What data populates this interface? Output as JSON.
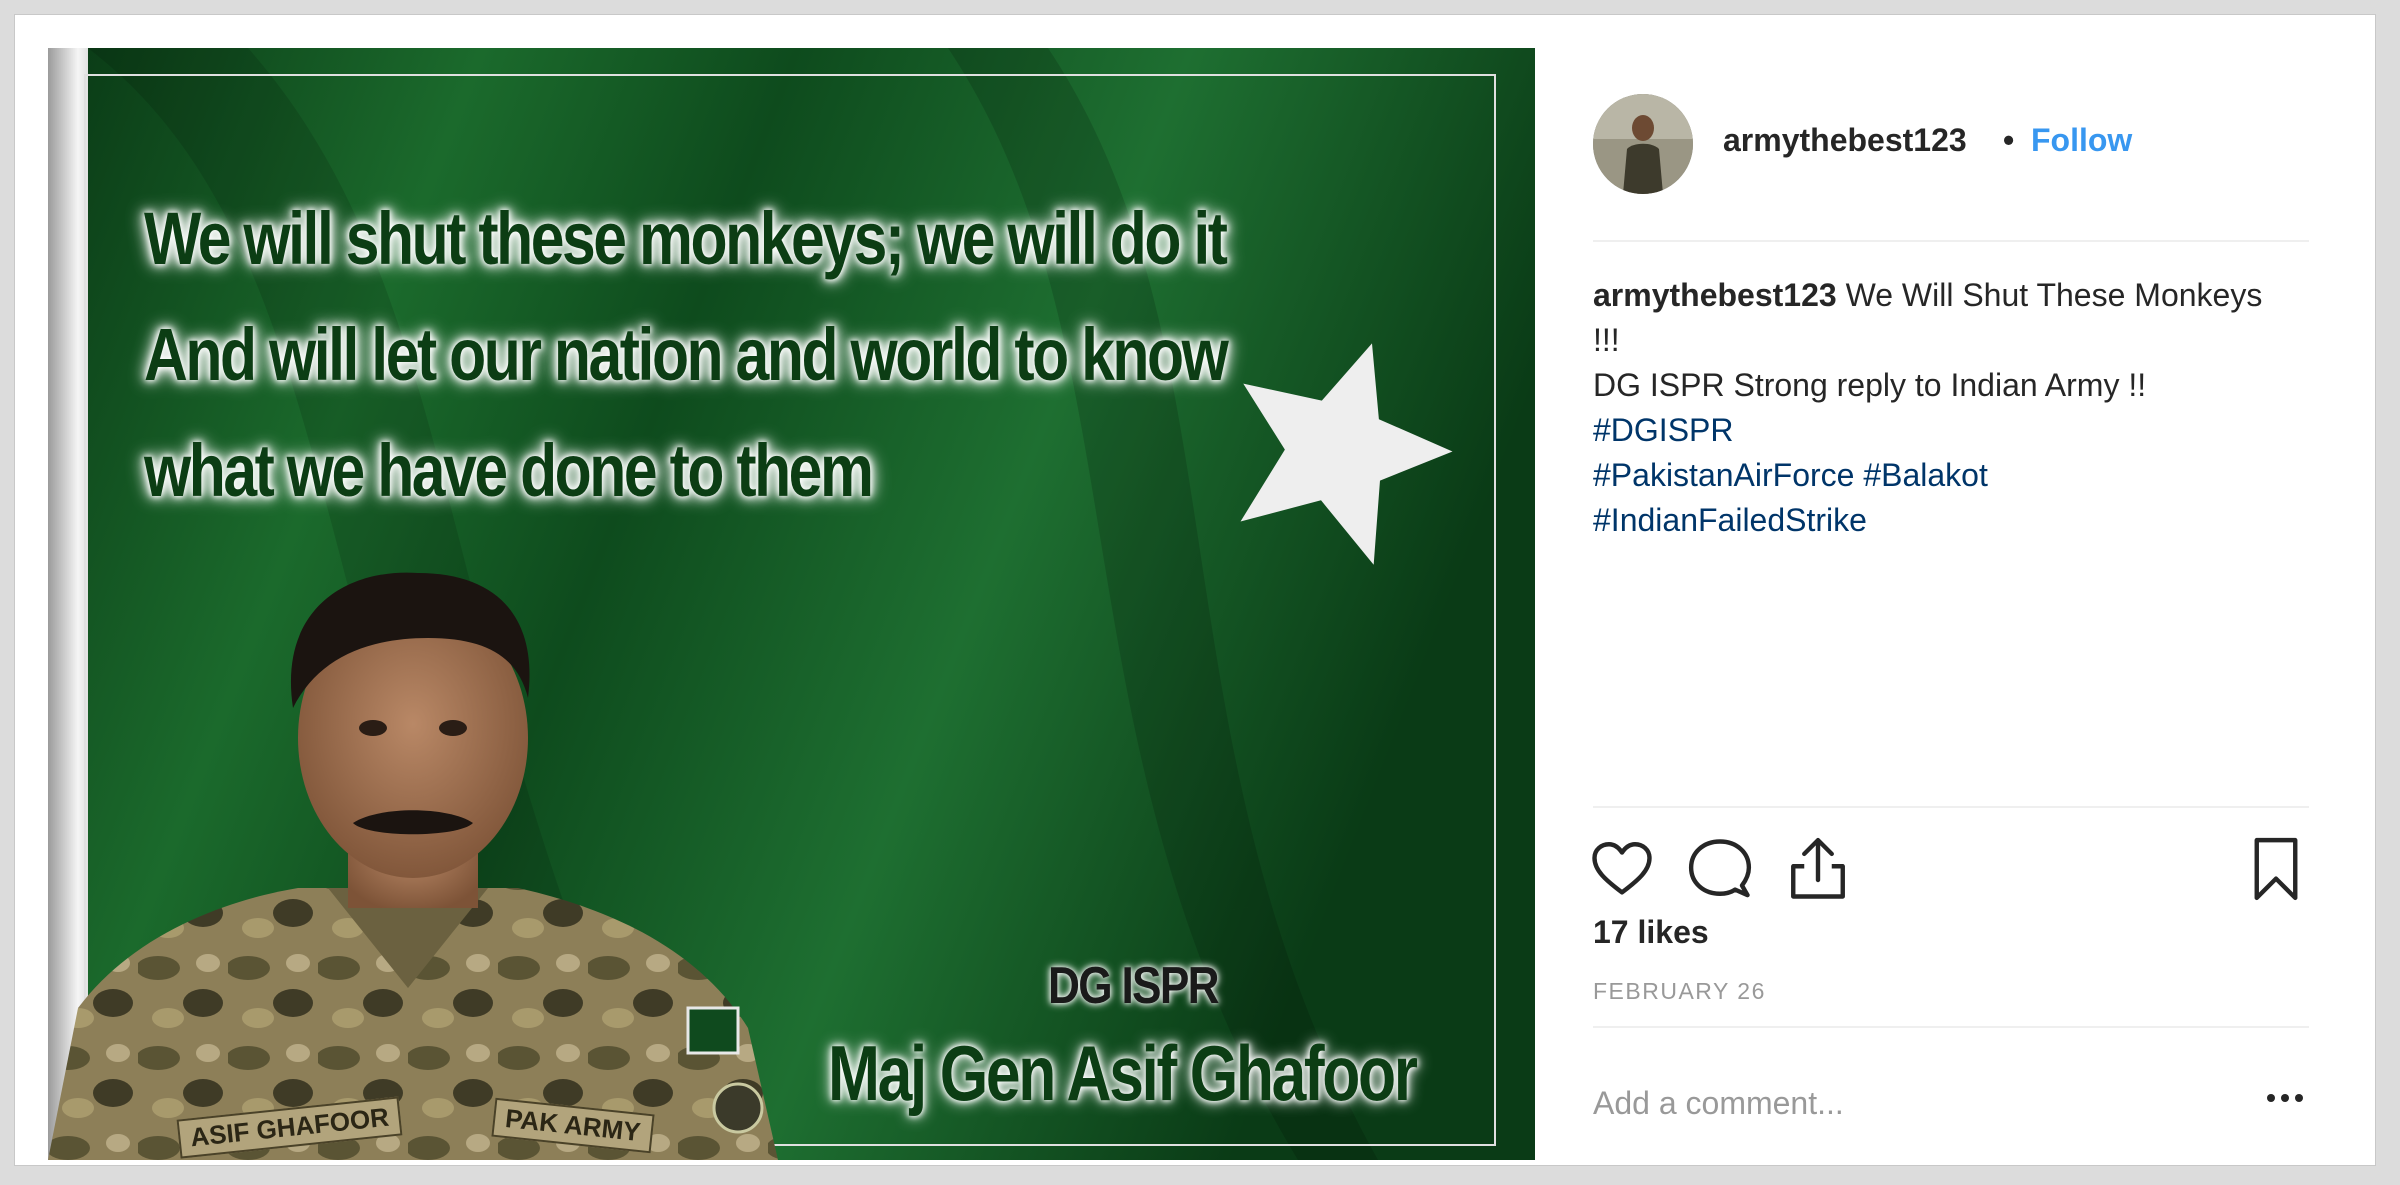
{
  "post_image": {
    "quote_lines": [
      "We will shut these monkeys; we will do it",
      "And will let our nation and world to know",
      "what we have done to them"
    ],
    "officer_title": "DG ISPR",
    "officer_name": "Maj Gen Asif Ghafoor",
    "name_tape": "ASIF GHAFOOR",
    "army_tape": "PAK ARMY"
  },
  "header": {
    "username": "armythebest123",
    "separator": "•",
    "follow_label": "Follow"
  },
  "caption": {
    "username": "armythebest123",
    "text_line1": "We Will Shut These Monkeys !!!",
    "text_line2": "DG ISPR Strong reply to Indian Army !!",
    "hashtags": [
      "#DGISPR",
      "#PakistanAirForce",
      "#Balakot",
      "#IndianFailedStrike"
    ]
  },
  "actions": {
    "icons": [
      "heart-icon",
      "comment-icon",
      "share-icon",
      "bookmark-icon"
    ]
  },
  "likes_text": "17 likes",
  "date_text": "FEBRUARY 26",
  "comment": {
    "placeholder": "Add a comment...",
    "value": ""
  },
  "more_icon": "ellipsis-icon",
  "colors": {
    "flag_green": "#0f4a1e",
    "flag_white": "#f2f2f2",
    "link_blue": "#3897f0",
    "hashtag_blue": "#003569",
    "text_dark": "#262626",
    "muted": "#999999"
  }
}
